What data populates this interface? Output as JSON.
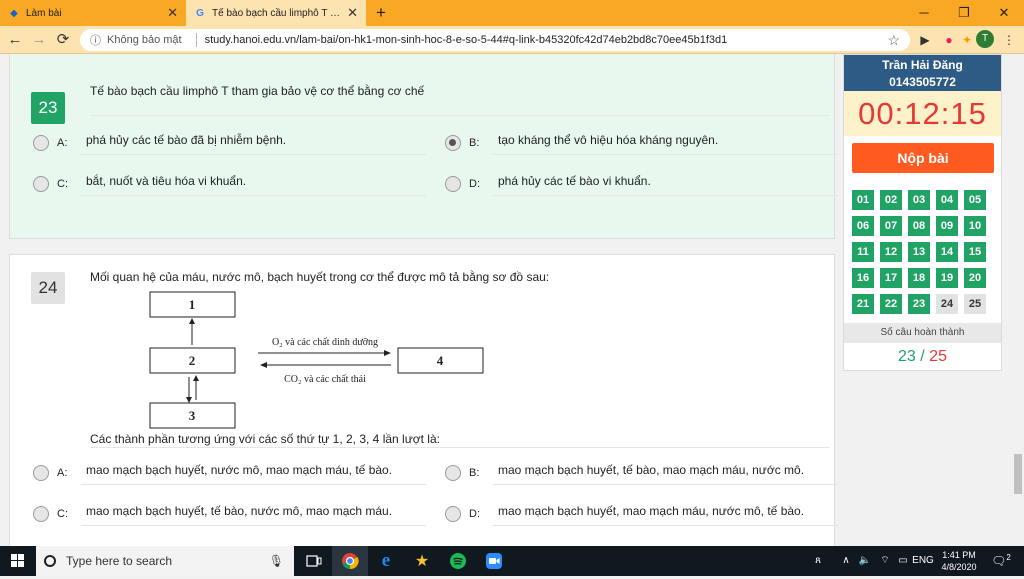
{
  "browser": {
    "tabs": [
      {
        "title": "Làm bài",
        "icon": "diamond-icon",
        "active": false
      },
      {
        "title": "Tế bào bạch cầu limphô T tham gi…",
        "icon": "google-icon",
        "active": true
      }
    ],
    "window_controls": {
      "minimize": "─",
      "restore": "❐",
      "close": "✕"
    },
    "security_label": "Không bảo mật",
    "url": "study.hanoi.edu.vn/lam-bai/on-hk1-mon-sinh-hoc-8-e-so-5-44#q-link-b45320fc42d74eb2bd8c70ee45b1f3d1",
    "avatar_letter": "T"
  },
  "questions": [
    {
      "number": "23",
      "text": "Tế bào bạch cầu limphô T tham gia bảo vệ cơ thể bằng cơ chế",
      "options": [
        {
          "label": "A:",
          "text": "phá hủy các tế bào đã bị nhiễm bệnh.",
          "checked": false
        },
        {
          "label": "B:",
          "text": "tạo kháng thể vô hiệu hóa kháng nguyên.",
          "checked": true
        },
        {
          "label": "C:",
          "text": "bắt, nuốt và tiêu hóa vi khuẩn.",
          "checked": false
        },
        {
          "label": "D:",
          "text": "phá hủy các tế bào vi khuẩn.",
          "checked": false
        }
      ]
    },
    {
      "number": "24",
      "text": "Mối quan hệ của máu, nước mô, bạch huyết trong cơ thể được mô tả bằng sơ đồ sau:",
      "diagram": {
        "boxes": [
          "1",
          "2",
          "3",
          "4"
        ],
        "arrow_top_label": "O₂ và các chất dinh dưỡng",
        "arrow_bottom_label": "CO₂ và các chất thải"
      },
      "subtext": "Các thành phần tương ứng với các số thứ tự 1, 2, 3, 4 lần lượt là:",
      "options": [
        {
          "label": "A:",
          "text": "mao mạch bạch huyết, nước mô, mao mạch máu, tế bào.",
          "checked": false
        },
        {
          "label": "B:",
          "text": "mao mạch bạch huyết, tế bào, mao mạch máu, nước mô.",
          "checked": false
        },
        {
          "label": "C:",
          "text": "mao mạch bạch huyết, tế bào, nước mô, mao mạch máu.",
          "checked": false
        },
        {
          "label": "D:",
          "text": "mao mạch bạch huyết, mao mạch máu, nước mô, tế bào.",
          "checked": false
        }
      ]
    }
  ],
  "sidebar": {
    "student_name": "Trần Hải Đăng",
    "student_id": "0143505772",
    "timer": "00:12:15",
    "submit_label": "Nộp bài",
    "question_buttons": [
      {
        "n": "01",
        "done": true
      },
      {
        "n": "02",
        "done": true
      },
      {
        "n": "03",
        "done": true
      },
      {
        "n": "04",
        "done": true
      },
      {
        "n": "05",
        "done": true
      },
      {
        "n": "06",
        "done": true
      },
      {
        "n": "07",
        "done": true
      },
      {
        "n": "08",
        "done": true
      },
      {
        "n": "09",
        "done": true
      },
      {
        "n": "10",
        "done": true
      },
      {
        "n": "11",
        "done": true
      },
      {
        "n": "12",
        "done": true
      },
      {
        "n": "13",
        "done": true
      },
      {
        "n": "14",
        "done": true
      },
      {
        "n": "15",
        "done": true
      },
      {
        "n": "16",
        "done": true
      },
      {
        "n": "17",
        "done": true
      },
      {
        "n": "18",
        "done": true
      },
      {
        "n": "19",
        "done": true
      },
      {
        "n": "20",
        "done": true
      },
      {
        "n": "21",
        "done": true
      },
      {
        "n": "22",
        "done": true
      },
      {
        "n": "23",
        "done": true
      },
      {
        "n": "24",
        "done": false
      },
      {
        "n": "25",
        "done": false
      }
    ],
    "progress_label": "Số câu hoàn thành",
    "progress_done": "23",
    "progress_separator": "/",
    "progress_total": "25"
  },
  "taskbar": {
    "search_placeholder": "Type here to search",
    "language": "ENG",
    "time": "1:41 PM",
    "date": "4/8/2020",
    "notification_count": "2"
  },
  "colors": {
    "accent_green": "#21a366",
    "header_blue": "#2d5b86",
    "timer_red": "#e53935",
    "submit_orange": "#ff5a1f",
    "chrome_orange": "#f9a825"
  }
}
